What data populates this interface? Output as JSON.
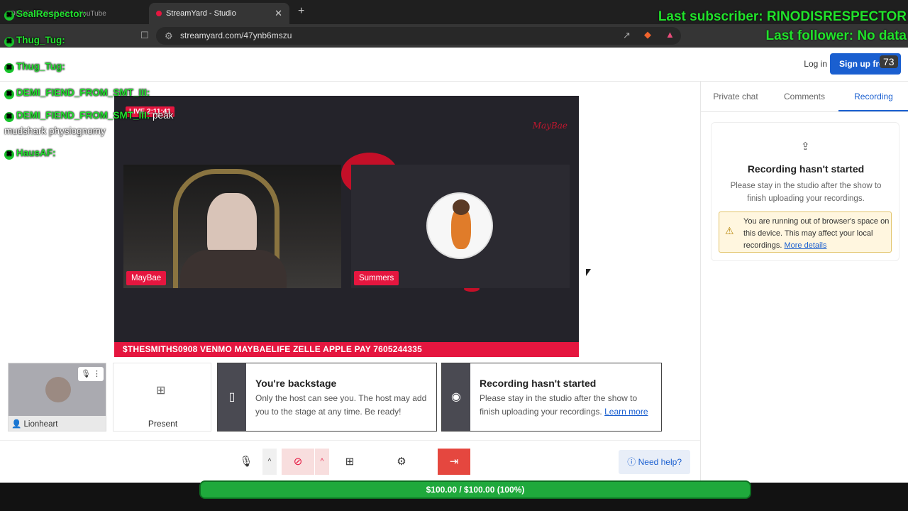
{
  "browser": {
    "tabs": [
      {
        "title": "OBSESSED MUCH - YouTube"
      },
      {
        "title": "StreamYard - Studio"
      }
    ],
    "url": "streamyard.com/47ynb6mszu"
  },
  "header": {
    "login": "Log in",
    "signup": "Sign up free"
  },
  "right_panel": {
    "tabs": [
      "Private chat",
      "Comments",
      "Recording"
    ],
    "active_tab": "Recording",
    "recording_title": "Recording hasn't started",
    "recording_desc": "Please stay in the studio after the show to finish uploading your recordings.",
    "warning_text": "You are running out of browser's space on this device. This may affect your local recordings.",
    "warning_link": "More details"
  },
  "stage": {
    "live_badge": "LIVE 2:11:41",
    "logo": "MayBae",
    "participants": [
      {
        "name": "MayBae"
      },
      {
        "name": "Summers"
      }
    ],
    "ticker": "$THESMITHS0908 VENMO MAYBAELIFE ZELLE APPLE PAY 7605244335"
  },
  "backstage": {
    "self_name": "Lionheart",
    "present_label": "Present",
    "backstage_title": "You're backstage",
    "backstage_desc": "Only the host can see you. The host may add you to the stage at any time. Be ready!",
    "recording_title": "Recording hasn't started",
    "recording_desc": "Please stay in the studio after the show to finish uploading your recordings.",
    "recording_link": "Learn more"
  },
  "controls": {
    "need_help": "Need help?"
  },
  "overlay": {
    "chat": [
      {
        "name": "SealRespector:",
        "msg": ""
      },
      {
        "name": "Thug_Tug:",
        "msg": ""
      },
      {
        "name": "Thug_Tug:",
        "msg": ""
      },
      {
        "name": "DEMI_FIEND_FROM_SMT_III:",
        "msg": ""
      },
      {
        "name": "DEMI_FIEND_FROM_SMT_III:",
        "msg": "peak"
      },
      {
        "name": "",
        "msg": "mudshark physiognomy"
      },
      {
        "name": "HausAF:",
        "msg": ""
      }
    ],
    "last_subscriber": "Last subscriber: RINODISRESPECTOR",
    "last_follower": "Last follower: No data",
    "viewer_count": "73",
    "goal": "$100.00 / $100.00 (100%)",
    "goal_fraction": 1.0
  },
  "colors": {
    "accent": "#1a5fd0",
    "live_red": "#e5163f",
    "chat_green": "#22e02f",
    "goal_green": "#1fa93c"
  }
}
